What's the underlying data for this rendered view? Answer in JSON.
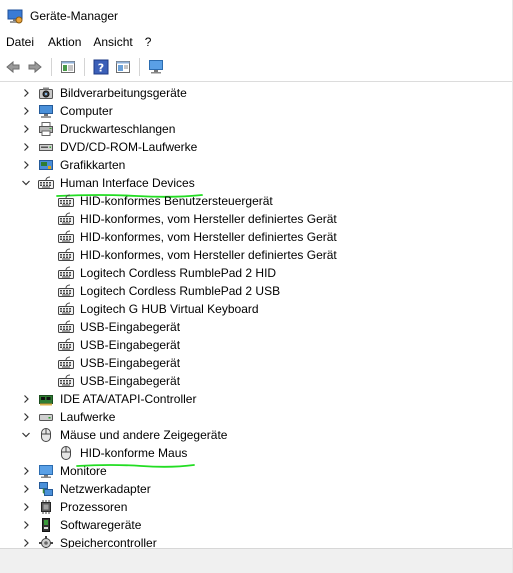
{
  "window": {
    "title": "Geräte-Manager"
  },
  "menu": [
    {
      "name": "menu-datei",
      "label": "Datei"
    },
    {
      "name": "menu-aktion",
      "label": "Aktion"
    },
    {
      "name": "menu-ansicht",
      "label": "Ansicht"
    },
    {
      "name": "menu-help",
      "label": "?"
    }
  ],
  "toolbar": {
    "back_icon": "back-arrow-icon",
    "forward_icon": "forward-arrow-icon",
    "properties_icon": "properties-icon",
    "help_icon": "help-icon",
    "update_driver_icon": "update-driver-icon",
    "monitor_icon": "monitor-icon"
  },
  "tree": [
    {
      "type": "category",
      "label": "Bildverarbeitungsgeräte",
      "expanded": false,
      "icon": "camera-icon"
    },
    {
      "type": "category",
      "label": "Computer",
      "expanded": false,
      "icon": "computer-icon"
    },
    {
      "type": "category",
      "label": "Druckwarteschlangen",
      "expanded": false,
      "icon": "printer-icon"
    },
    {
      "type": "category",
      "label": "DVD/CD-ROM-Laufwerke",
      "expanded": false,
      "icon": "dvd-drive-icon"
    },
    {
      "type": "category",
      "label": "Grafikkarten",
      "expanded": false,
      "icon": "display-adapter-icon"
    },
    {
      "type": "category",
      "label": "Human Interface Devices",
      "expanded": true,
      "icon": "keyboard-icon",
      "underlined": true
    },
    {
      "type": "device",
      "label": "HID-konformes Benutzersteuergerät",
      "icon": "keyboard-icon"
    },
    {
      "type": "device",
      "label": "HID-konformes, vom Hersteller definiertes Gerät",
      "icon": "keyboard-icon"
    },
    {
      "type": "device",
      "label": "HID-konformes, vom Hersteller definiertes Gerät",
      "icon": "keyboard-icon"
    },
    {
      "type": "device",
      "label": "HID-konformes, vom Hersteller definiertes Gerät",
      "icon": "keyboard-icon"
    },
    {
      "type": "device",
      "label": "Logitech Cordless RumblePad 2 HID",
      "icon": "keyboard-icon"
    },
    {
      "type": "device",
      "label": "Logitech Cordless RumblePad 2 USB",
      "icon": "keyboard-icon"
    },
    {
      "type": "device",
      "label": "Logitech G HUB Virtual Keyboard",
      "icon": "keyboard-icon"
    },
    {
      "type": "device",
      "label": "USB-Eingabegerät",
      "icon": "keyboard-icon"
    },
    {
      "type": "device",
      "label": "USB-Eingabegerät",
      "icon": "keyboard-icon"
    },
    {
      "type": "device",
      "label": "USB-Eingabegerät",
      "icon": "keyboard-icon"
    },
    {
      "type": "device",
      "label": "USB-Eingabegerät",
      "icon": "keyboard-icon"
    },
    {
      "type": "category",
      "label": "IDE ATA/ATAPI-Controller",
      "expanded": false,
      "icon": "ide-controller-icon"
    },
    {
      "type": "category",
      "label": "Laufwerke",
      "expanded": false,
      "icon": "disk-drive-icon"
    },
    {
      "type": "category",
      "label": "Mäuse und andere Zeigegeräte",
      "expanded": true,
      "icon": "mouse-icon"
    },
    {
      "type": "device",
      "label": "HID-konforme Maus",
      "icon": "mouse-icon",
      "underlined": true
    },
    {
      "type": "category",
      "label": "Monitore",
      "expanded": false,
      "icon": "monitor-icon"
    },
    {
      "type": "category",
      "label": "Netzwerkadapter",
      "expanded": false,
      "icon": "network-adapter-icon"
    },
    {
      "type": "category",
      "label": "Prozessoren",
      "expanded": false,
      "icon": "processor-icon"
    },
    {
      "type": "category",
      "label": "Softwaregeräte",
      "expanded": false,
      "icon": "software-device-icon"
    },
    {
      "type": "category",
      "label": "Speichercontroller",
      "expanded": false,
      "icon": "storage-controller-icon"
    }
  ],
  "colors": {
    "annotation_underline": "#22dd22",
    "icon_blue": "#2a6bc4",
    "icon_gray": "#7a7a7a"
  }
}
